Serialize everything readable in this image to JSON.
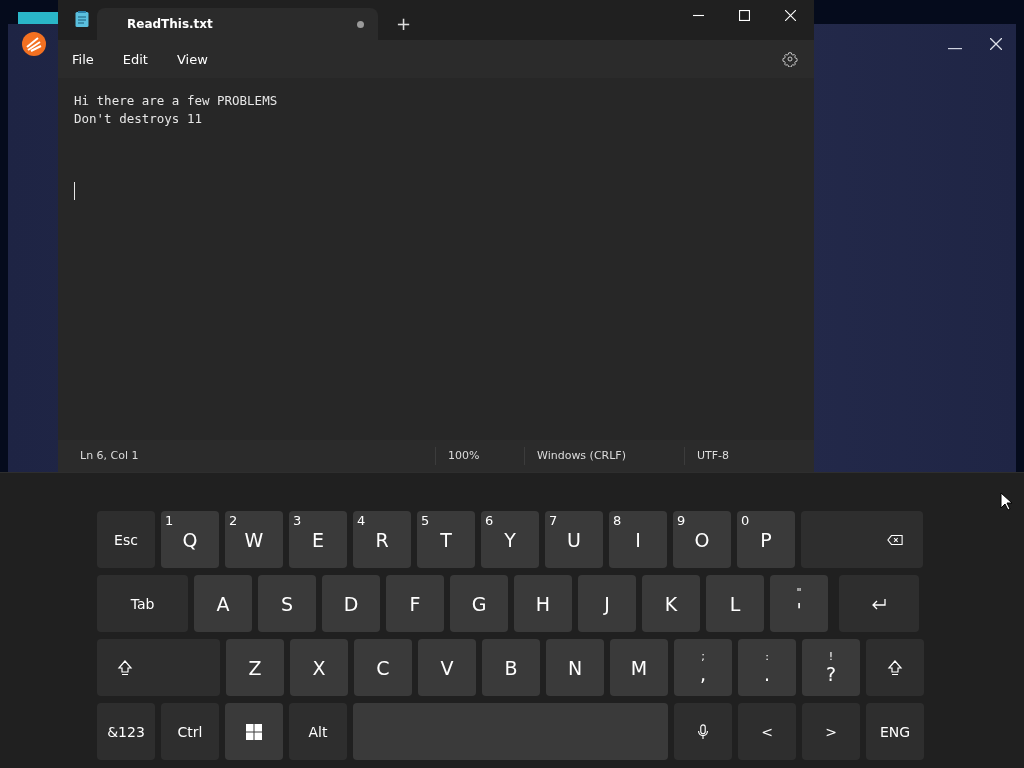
{
  "notepad": {
    "tab": {
      "title": "ReadThis.txt",
      "modified": true
    },
    "new_tab": "+",
    "menu": [
      "File",
      "Edit",
      "View"
    ],
    "lines": [
      "Hi there are a few PROBLEMS",
      "Don't destroys 11"
    ],
    "status_bar": [
      "Ln 6, Col 1",
      "100%",
      "Windows (CRLF)",
      "UTF-8"
    ]
  },
  "keyboard": {
    "rows": [
      {
        "keys": [
          {
            "kind": "function",
            "label": "Esc"
          },
          {
            "kind": "letter",
            "label": "Q",
            "secondary": "1"
          },
          {
            "kind": "letter",
            "label": "W",
            "secondary": "2"
          },
          {
            "kind": "letter",
            "label": "E",
            "secondary": "3"
          },
          {
            "kind": "letter",
            "label": "R",
            "secondary": "4"
          },
          {
            "kind": "letter",
            "label": "T",
            "secondary": "5"
          },
          {
            "kind": "letter",
            "label": "Y",
            "secondary": "6"
          },
          {
            "kind": "letter",
            "label": "U",
            "secondary": "7"
          },
          {
            "kind": "letter",
            "label": "I",
            "secondary": "8"
          },
          {
            "kind": "letter",
            "label": "O",
            "secondary": "9"
          },
          {
            "kind": "letter",
            "label": "P",
            "secondary": "0"
          },
          {
            "kind": "backspace"
          }
        ]
      },
      {
        "keys": [
          {
            "kind": "tab",
            "label": "Tab"
          },
          {
            "kind": "letter",
            "label": "A"
          },
          {
            "kind": "letter",
            "label": "S"
          },
          {
            "kind": "letter",
            "label": "D"
          },
          {
            "kind": "letter",
            "label": "F"
          },
          {
            "kind": "letter",
            "label": "G"
          },
          {
            "kind": "letter",
            "label": "H"
          },
          {
            "kind": "letter",
            "label": "J"
          },
          {
            "kind": "letter",
            "label": "K"
          },
          {
            "kind": "letter",
            "label": "L"
          },
          {
            "kind": "symbol",
            "label": "'",
            "secondary": "\""
          },
          {
            "kind": "enter"
          }
        ]
      },
      {
        "keys": [
          {
            "kind": "shift"
          },
          {
            "kind": "letter",
            "label": "Z"
          },
          {
            "kind": "letter",
            "label": "X"
          },
          {
            "kind": "letter",
            "label": "C"
          },
          {
            "kind": "letter",
            "label": "V"
          },
          {
            "kind": "letter",
            "label": "B"
          },
          {
            "kind": "letter",
            "label": "N"
          },
          {
            "kind": "letter",
            "label": "M"
          },
          {
            "kind": "symbol",
            "label": ",",
            "secondary": ";"
          },
          {
            "kind": "symbol",
            "label": ".",
            "secondary": ":"
          },
          {
            "kind": "symbol",
            "label": "?",
            "secondary": "!"
          },
          {
            "kind": "shift"
          }
        ]
      },
      {
        "keys": [
          {
            "kind": "function",
            "label": "&123"
          },
          {
            "kind": "function",
            "label": "Ctrl"
          },
          {
            "kind": "windows"
          },
          {
            "kind": "function",
            "label": "Alt"
          },
          {
            "kind": "space"
          },
          {
            "kind": "mic"
          },
          {
            "kind": "function",
            "label": "<"
          },
          {
            "kind": "function",
            "label": ">"
          },
          {
            "kind": "function",
            "label": "ENG"
          }
        ]
      }
    ]
  }
}
